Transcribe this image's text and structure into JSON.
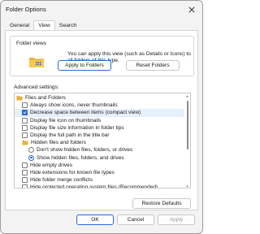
{
  "window": {
    "title": "Folder Options"
  },
  "tabs": [
    "General",
    "View",
    "Search"
  ],
  "folder_views": {
    "label": "Folder views",
    "description": "You can apply this view (such as Details or Icons) to all folders of this type.",
    "apply_button": "Apply to Folders",
    "reset_button": "Reset Folders"
  },
  "advanced": {
    "label": "Advanced settings:",
    "items": [
      {
        "label": "Files and Folders",
        "kind": "folder",
        "indent": 0
      },
      {
        "label": "Always show icons, never thumbnails",
        "kind": "checkbox",
        "checked": false,
        "indent": 1
      },
      {
        "label": "Decrease space between items (compact view)",
        "kind": "checkbox",
        "checked": true,
        "indent": 1,
        "highlight": true
      },
      {
        "label": "Display file icon on thumbnails",
        "kind": "checkbox",
        "checked": false,
        "indent": 1
      },
      {
        "label": "Display file size information in folder tips",
        "kind": "checkbox",
        "checked": false,
        "indent": 1
      },
      {
        "label": "Display the full path in the title bar",
        "kind": "checkbox",
        "checked": false,
        "indent": 1
      },
      {
        "label": "Hidden files and folders",
        "kind": "folder",
        "indent": 1
      },
      {
        "label": "Don't show hidden files, folders, or drives",
        "kind": "radio",
        "checked": false,
        "indent": 2
      },
      {
        "label": "Show hidden files, folders, and drives",
        "kind": "radio",
        "checked": true,
        "indent": 2
      },
      {
        "label": "Hide empty drives",
        "kind": "checkbox",
        "checked": false,
        "indent": 1
      },
      {
        "label": "Hide extensions for known file types",
        "kind": "checkbox",
        "checked": false,
        "indent": 1
      },
      {
        "label": "Hide folder merge conflicts",
        "kind": "checkbox",
        "checked": false,
        "indent": 1
      },
      {
        "label": "Hide protected operating system files (Recommended)",
        "kind": "checkbox",
        "checked": false,
        "indent": 1
      }
    ],
    "restore_button": "Restore Defaults"
  },
  "footer": {
    "ok": "OK",
    "cancel": "Cancel",
    "apply": "Apply"
  },
  "colors": {
    "accent": "#2a6bd4",
    "folder": "#e8b23a",
    "highlight": "#e5f0fb"
  }
}
